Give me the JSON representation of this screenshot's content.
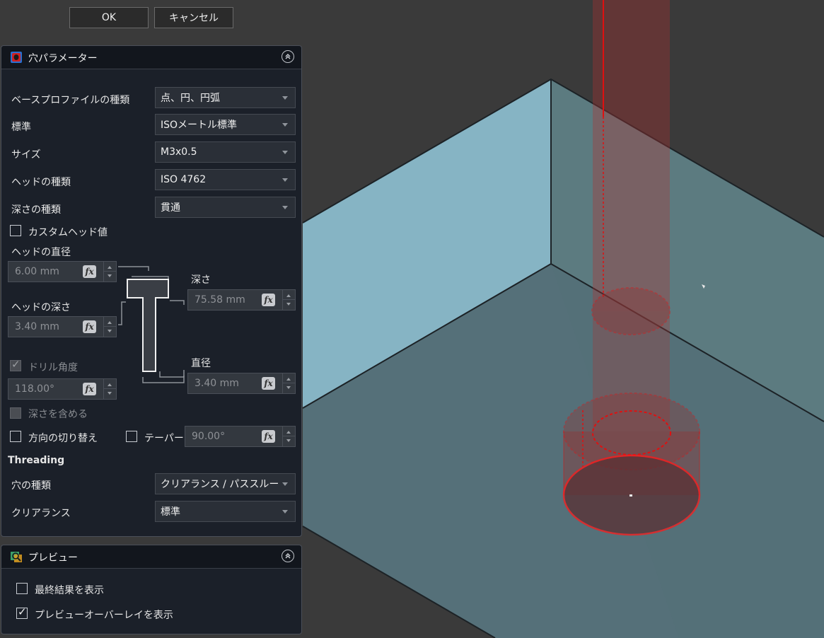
{
  "buttons": {
    "ok": "OK",
    "cancel": "キャンセル"
  },
  "hole_panel": {
    "title": "穴パラメーター",
    "profile_type": {
      "label": "ベースプロファイルの種類",
      "value": "点、円、円弧"
    },
    "standard": {
      "label": "標準",
      "value": "ISOメートル標準"
    },
    "size": {
      "label": "サイズ",
      "value": "M3x0.5"
    },
    "head_type": {
      "label": "ヘッドの種類",
      "value": "ISO 4762"
    },
    "depth_type": {
      "label": "深さの種類",
      "value": "貫通"
    },
    "custom_head": {
      "label": "カスタムヘッド値",
      "checked": false
    },
    "head_diameter": {
      "label": "ヘッドの直径",
      "value": "6.00 mm"
    },
    "head_depth": {
      "label": "ヘッドの深さ",
      "value": "3.40 mm"
    },
    "depth": {
      "label": "深さ",
      "value": "75.58 mm"
    },
    "diameter": {
      "label": "直径",
      "value": "3.40 mm"
    },
    "drill_angle": {
      "label": "ドリル角度",
      "value": "118.00°",
      "checked": true
    },
    "include_depth": {
      "label": "深さを含める",
      "checked": false
    },
    "reverse": {
      "label": "方向の切り替え",
      "checked": false
    },
    "taper": {
      "label": "テーパー",
      "value": "90.00°",
      "checked": false
    },
    "threading_heading": "Threading",
    "hole_kind": {
      "label": "穴の種類",
      "value": "クリアランス / パススルー"
    },
    "clearance": {
      "label": "クリアランス",
      "value": "標準"
    },
    "fx_label": "fx"
  },
  "preview_panel": {
    "title": "プレビュー",
    "show_final": {
      "label": "最終結果を表示",
      "checked": false
    },
    "show_overlay": {
      "label": "プレビューオーバーレイを表示",
      "checked": true,
      "mark": "✓"
    }
  },
  "colors": {
    "panel_bg": "#1b2029",
    "viewport_bg": "#3a3a3a",
    "face_left": "#86b4c4",
    "face_right": "#5c7b80",
    "face_bottom": "#557079",
    "preview_red": "#e01010"
  }
}
